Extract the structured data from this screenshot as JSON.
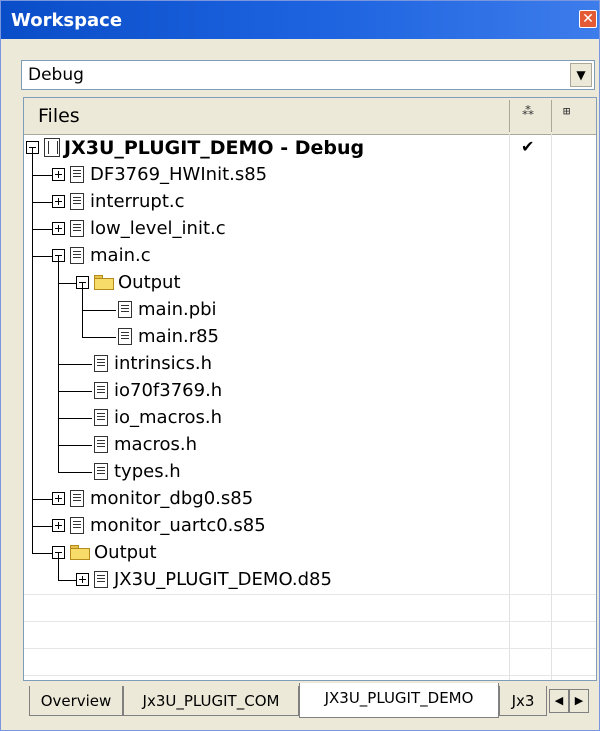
{
  "window": {
    "title": "Workspace",
    "close_glyph": "✕"
  },
  "config": {
    "value": "Debug",
    "arrow": "▼"
  },
  "header": {
    "files": "Files"
  },
  "tree": [
    {
      "label": "JX3U_PLUGIT_DEMO - Debug",
      "check": "✔"
    },
    {
      "label": "DF3769_HWInit.s85"
    },
    {
      "label": "interrupt.c"
    },
    {
      "label": "low_level_init.c"
    },
    {
      "label": "main.c"
    },
    {
      "label": "Output"
    },
    {
      "label": "main.pbi"
    },
    {
      "label": "main.r85"
    },
    {
      "label": "intrinsics.h"
    },
    {
      "label": "io70f3769.h"
    },
    {
      "label": "io_macros.h"
    },
    {
      "label": "macros.h"
    },
    {
      "label": "types.h"
    },
    {
      "label": "monitor_dbg0.s85"
    },
    {
      "label": "monitor_uartc0.s85"
    },
    {
      "label": "Output"
    },
    {
      "label": "JX3U_PLUGIT_DEMO.d85"
    }
  ],
  "tabs": [
    "Overview",
    "Jx3U_PLUGIT_COM",
    "JX3U_PLUGIT_DEMO",
    "Jx3"
  ],
  "nav": {
    "left": "◀",
    "right": "▶"
  }
}
